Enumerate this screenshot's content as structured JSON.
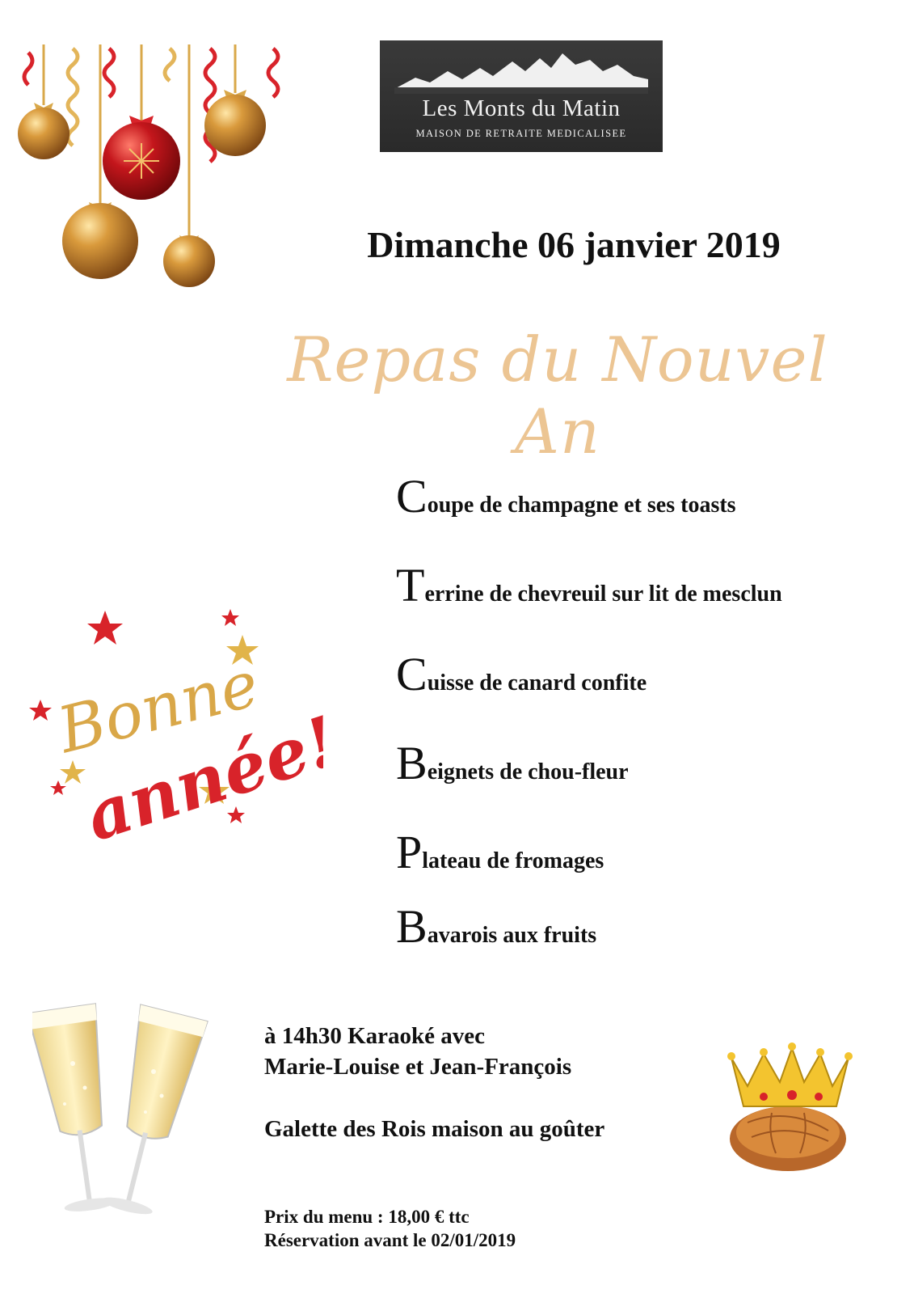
{
  "logo": {
    "name": "Les Monts du Matin",
    "subtitle": "MAISON DE RETRAITE MEDICALISEE"
  },
  "date": "Dimanche 06 janvier 2019",
  "title": "Repas du Nouvel An",
  "menu": [
    {
      "initial": "C",
      "rest": "oupe de champagne et ses toasts"
    },
    {
      "initial": "T",
      "rest": "errine de chevreuil  sur lit de mesclun"
    },
    {
      "initial": "C",
      "rest": "uisse de canard confite"
    },
    {
      "initial": "B",
      "rest": "eignets de chou-fleur"
    },
    {
      "initial": "P",
      "rest": "lateau de fromages"
    },
    {
      "initial": "B",
      "rest": "avarois aux fruits"
    }
  ],
  "greeting": {
    "line1": "Bonne",
    "line2": "année!"
  },
  "activity": {
    "line1": "à 14h30 Karaoké avec",
    "line2": "Marie-Louise et Jean-François"
  },
  "galette": "Galette des Rois maison au goûter",
  "footer": {
    "price": "Prix du menu : 18,00 € ttc",
    "reservation": "Réservation avant le 02/01/2019"
  },
  "colors": {
    "gold": "#c8903a",
    "red": "#d8232a",
    "script_title": "#ecc593"
  }
}
